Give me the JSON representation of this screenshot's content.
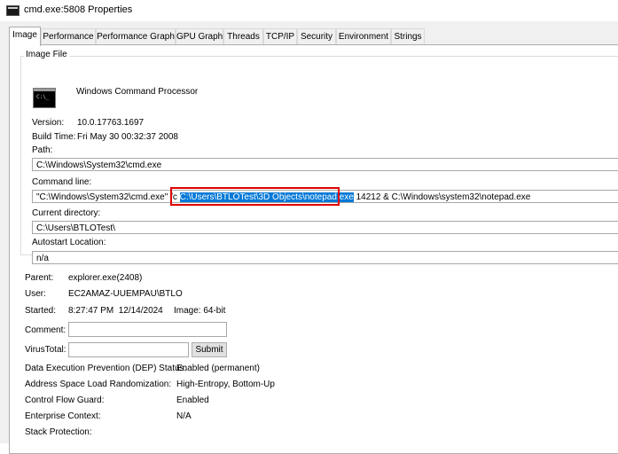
{
  "window": {
    "title": "cmd.exe:5808 Properties"
  },
  "tabs": [
    {
      "label": "Image"
    },
    {
      "label": "Performance"
    },
    {
      "label": "Performance Graph"
    },
    {
      "label": "GPU Graph"
    },
    {
      "label": "Threads"
    },
    {
      "label": "TCP/IP"
    },
    {
      "label": "Security"
    },
    {
      "label": "Environment"
    },
    {
      "label": "Strings"
    }
  ],
  "image_file": {
    "legend": "Image File",
    "description": "Windows Command Processor",
    "version_label": "Version:",
    "version": "10.0.17763.1697",
    "build_time_label": "Build Time:",
    "build_time": "Fri May 30 00:32:37 2008",
    "path_label": "Path:",
    "path": "C:\\Windows\\System32\\cmd.exe",
    "cmdline_label": "Command line:",
    "cmdline_before": "\"C:\\Windows\\System32\\cmd.exe\" /c ",
    "cmdline_selected": "C:\\Users\\BTLOTest\\3D Objects\\notepad.exe",
    "cmdline_after": " 14212 & C:\\Windows\\system32\\notepad.exe",
    "curdir_label": "Current directory:",
    "curdir": "C:\\Users\\BTLOTest\\",
    "autostart_label": "Autostart Location:",
    "autostart": "n/a"
  },
  "process": {
    "parent_label": "Parent:",
    "parent": "explorer.exe(2408)",
    "user_label": "User:",
    "user": "EC2AMAZ-UUEMPAU\\BTLO",
    "started_label": "Started:",
    "started": "8:27:47 PM  12/14/2024",
    "image_label": "Image: 64-bit",
    "comment_label": "Comment:",
    "comment": "",
    "virustotal_label": "VirusTotal:",
    "virustotal": "",
    "submit_label": "Submit"
  },
  "security": {
    "dep_label": "Data Execution Prevention (DEP) Status:",
    "dep": "Enabled (permanent)",
    "aslr_label": "Address Space Load Randomization:",
    "aslr": "High-Entropy, Bottom-Up",
    "cfg_label": "Control Flow Guard:",
    "cfg": "Enabled",
    "enterprise_label": "Enterprise Context:",
    "enterprise": "N/A",
    "stack_label": "Stack Protection:",
    "stack": ""
  }
}
